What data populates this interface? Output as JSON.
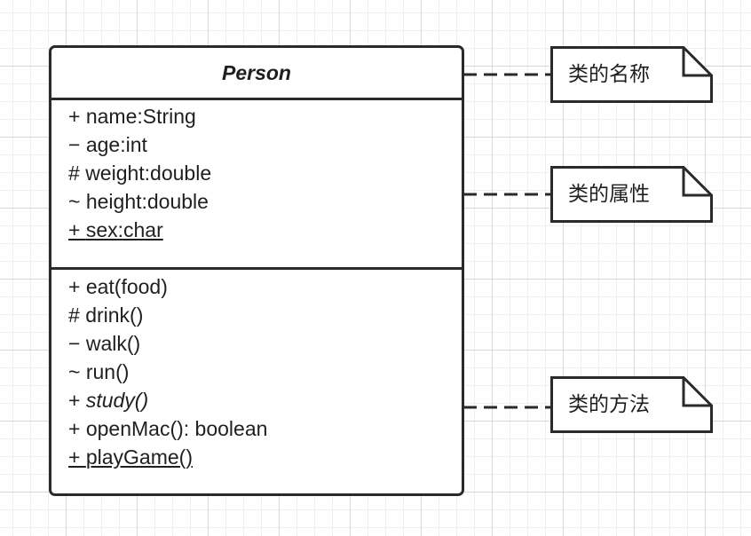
{
  "class": {
    "name": "Person",
    "attributes": [
      {
        "visibility": "+",
        "text": "name:String",
        "static": false
      },
      {
        "visibility": "−",
        "text": "age:int",
        "static": false
      },
      {
        "visibility": "#",
        "text": "weight:double",
        "static": false
      },
      {
        "visibility": "~",
        "text": "height:double",
        "static": false
      },
      {
        "visibility": "+",
        "text": "sex:char",
        "static": true
      }
    ],
    "methods": [
      {
        "visibility": "+",
        "text": "eat(food)",
        "static": false,
        "abstract": false
      },
      {
        "visibility": "#",
        "text": "drink()",
        "static": false,
        "abstract": false
      },
      {
        "visibility": "−",
        "text": "walk()",
        "static": false,
        "abstract": false
      },
      {
        "visibility": "~",
        "text": "run()",
        "static": false,
        "abstract": false
      },
      {
        "visibility": "+",
        "text": "study()",
        "static": false,
        "abstract": true
      },
      {
        "visibility": "+",
        "text": "openMac(): boolean",
        "static": false,
        "abstract": false
      },
      {
        "visibility": "+",
        "text": "playGame()",
        "static": true,
        "abstract": false
      }
    ]
  },
  "notes": {
    "class_name": "类的名称",
    "attributes": "类的属性",
    "methods": "类的方法"
  },
  "colors": {
    "stroke": "#2a2a2a",
    "grid_major": "#d9d9d9",
    "grid_minor": "#efefef",
    "background": "#ffffff"
  }
}
